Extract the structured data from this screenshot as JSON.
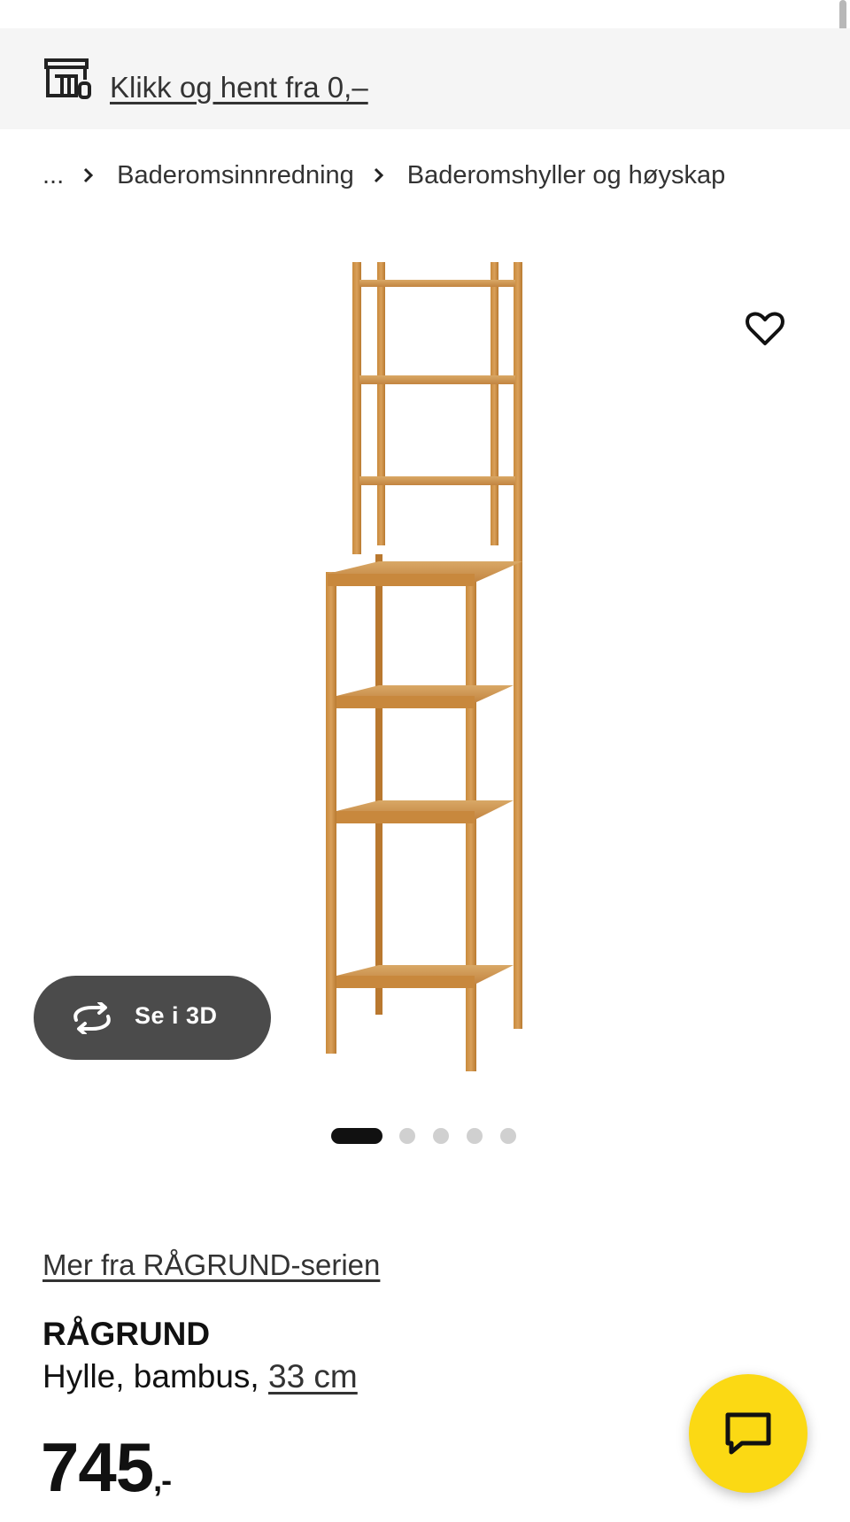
{
  "promo": {
    "text": "Klikk og hent fra 0,–",
    "icon": "store-pickup-icon"
  },
  "breadcrumb": {
    "ellipsis": "...",
    "items": [
      "Baderomsinnredning",
      "Baderomshyller og høyskap"
    ]
  },
  "gallery": {
    "button_3d_label": "Se i 3D",
    "image_count": 5,
    "active_image": 1
  },
  "product": {
    "series_link": "Mer fra RÅGRUND-serien",
    "name": "RÅGRUND",
    "description": "Hylle, bambus, ",
    "size": "33 cm",
    "price": "745",
    "price_suffix": ",-"
  },
  "colors": {
    "chat_button": "#fbd914",
    "button_3d": "#4b4b4b",
    "promo_bg": "#f5f5f5"
  }
}
